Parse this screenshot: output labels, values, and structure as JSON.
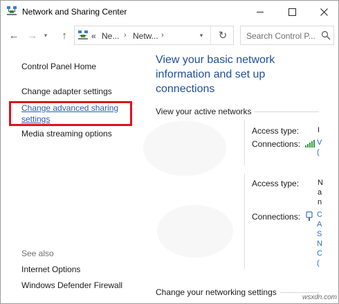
{
  "window": {
    "title": "Network and Sharing Center"
  },
  "address": {
    "overflow": "«",
    "crumbs": [
      "Ne...",
      "Netw..."
    ],
    "search_placeholder": "Search Control P..."
  },
  "sidebar": {
    "home": "Control Panel Home",
    "adapter": "Change adapter settings",
    "advanced_line1": "Change advanced sharing",
    "advanced_line2": "settings",
    "media": "Media streaming options",
    "see_also": "See also",
    "internet_options": "Internet Options",
    "firewall": "Windows Defender Firewall"
  },
  "main": {
    "heading_line1": "View your basic network",
    "heading_line2": "information and set up",
    "heading_line3": "connections",
    "active_networks": "View your active networks",
    "access_type_label": "Access type:",
    "connections_label": "Connections:",
    "networking_settings": "Change your networking settings"
  },
  "watermark": "wsxdn.com",
  "colors": {
    "heading_blue": "#1f4e9c",
    "link_blue": "#2a5daa",
    "highlight_red": "#e1111a"
  }
}
